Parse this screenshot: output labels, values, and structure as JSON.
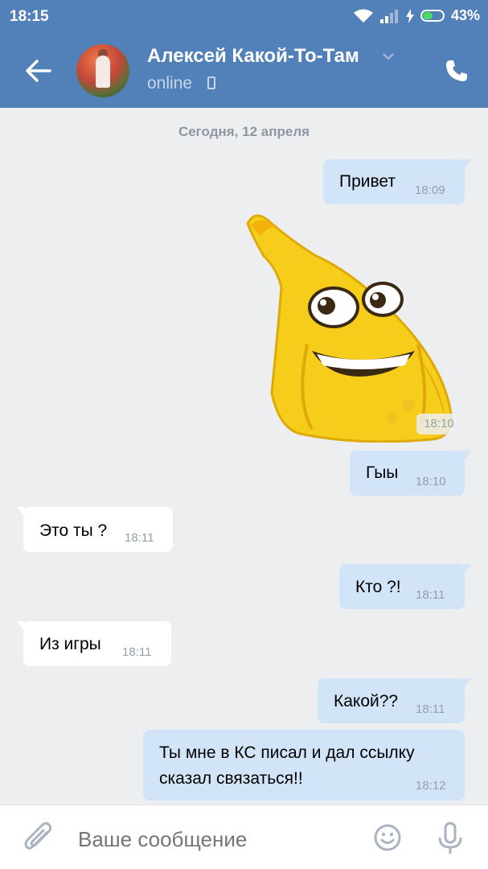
{
  "status_bar": {
    "time": "18:15",
    "battery": "43%"
  },
  "header": {
    "name": "Алексей Какой-То-Там",
    "presence": "online"
  },
  "chat": {
    "date_divider": "Сегодня, 12 апреля",
    "messages": [
      {
        "text": "Привет",
        "time": "18:09"
      },
      {
        "time": "18:10"
      },
      {
        "text": "Гыы",
        "time": "18:10"
      },
      {
        "text": "Это ты ?",
        "time": "18:11"
      },
      {
        "text": "Кто ?!",
        "time": "18:11"
      },
      {
        "text": "Из игры",
        "time": "18:11"
      },
      {
        "text": "Какой??",
        "time": "18:11"
      },
      {
        "line1": "Ты мне в КС писал и дал ссылку",
        "line2": "сказал связаться!!",
        "time": "18:12"
      }
    ]
  },
  "composer": {
    "placeholder": "Ваше сообщение"
  },
  "colors": {
    "header": "#5181b8",
    "outgoing_bubble": "#d2e4f7",
    "incoming_bubble": "#ffffff",
    "background": "#edeef0"
  }
}
